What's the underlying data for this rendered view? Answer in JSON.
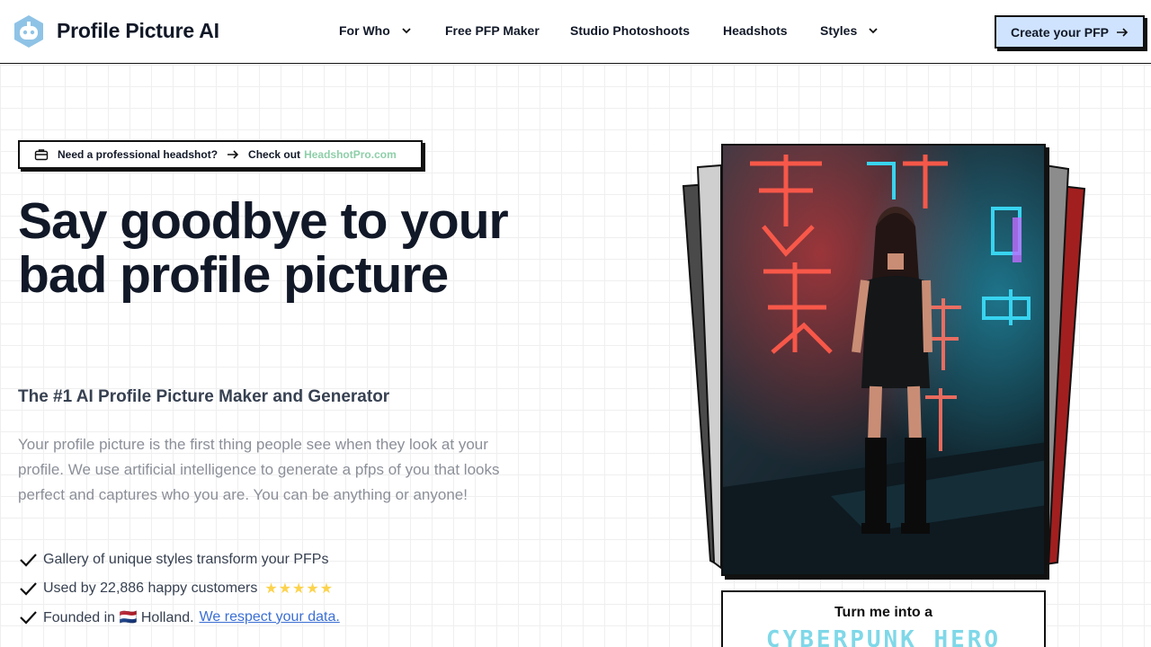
{
  "header": {
    "brand": "Profile Picture AI",
    "nav": [
      {
        "label": "For Who",
        "has_dropdown": true
      },
      {
        "label": "Free PFP Maker",
        "has_dropdown": false
      },
      {
        "label": "Studio Photoshoots",
        "has_dropdown": false
      },
      {
        "label": "Headshots",
        "has_dropdown": false
      },
      {
        "label": "Styles",
        "has_dropdown": true
      }
    ],
    "cta_label": "Create your PFP"
  },
  "announcement": {
    "icon": "briefcase-icon",
    "text": "Need a professional headshot?",
    "link_prefix": "Check out",
    "link_text": "HeadshotPro.com"
  },
  "hero": {
    "title": "Say goodbye to your bad profile picture",
    "subtitle": "The #1 AI Profile Picture Maker and Generator",
    "description": "Your profile picture is the first thing people see when they look at your profile. We use artificial intelligence to generate a pfps of you that looks perfect and captures who you are. You can be anything or anyone!",
    "features": [
      {
        "text": "Gallery of unique styles transform your PFPs"
      },
      {
        "text": "Used by 22,886 happy customers",
        "stars": "★★★★★"
      },
      {
        "text": "Founded in 🇳🇱 Holland.",
        "link": "We respect your data."
      }
    ]
  },
  "showcase": {
    "turn_into": "Turn me into a",
    "style_name": "CYBERPUNK HERO"
  },
  "colors": {
    "cta_bg": "#cfe3ff",
    "link_green": "#8ecfa9",
    "link_blue": "#3b6fd4",
    "star": "#fcd34d",
    "cyan_text": "#7fd8e8"
  }
}
